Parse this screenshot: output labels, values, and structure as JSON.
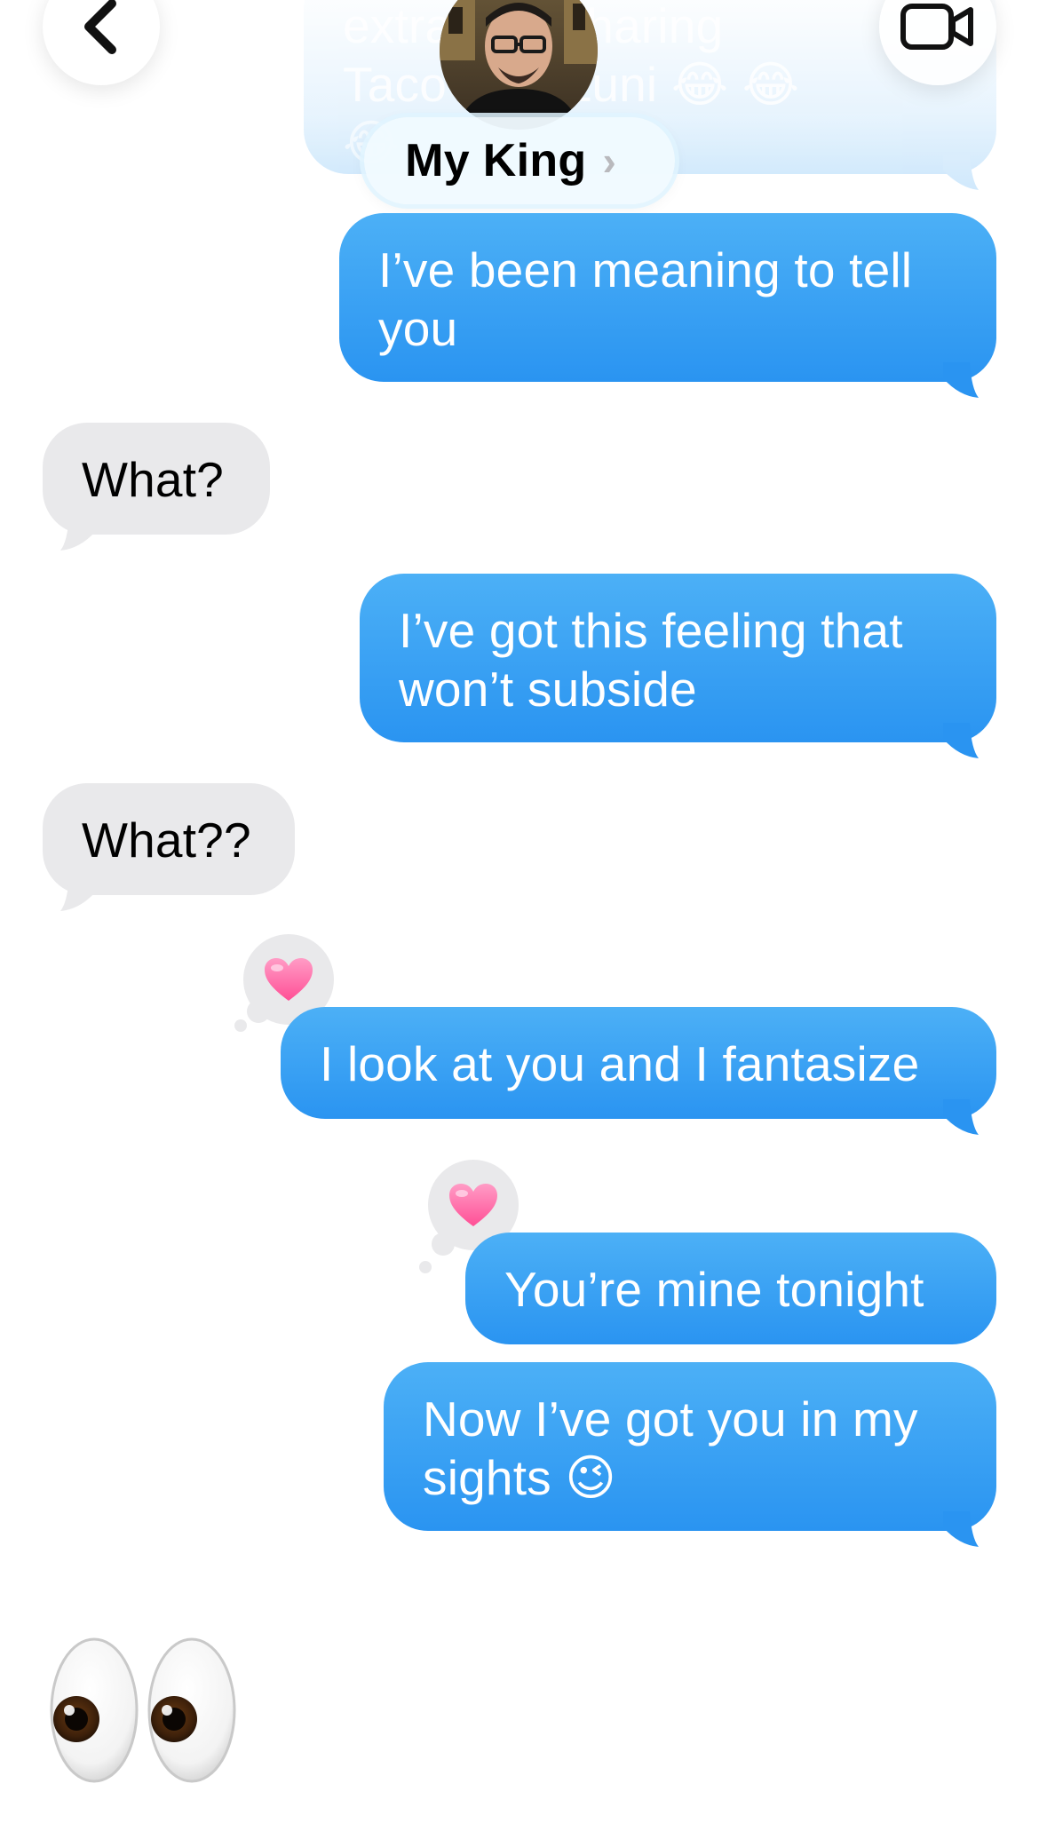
{
  "header": {
    "contact_name": "My King",
    "chevron": "chevron-right-icon",
    "back_icon": "chevron-left-icon",
    "video_icon": "video-camera-icon",
    "avatar": "contact-avatar-photo"
  },
  "colors": {
    "outgoing_bubble": "#2a94f1",
    "incoming_bubble": "#e9e9eb",
    "reaction_heart": "#ff6fa8"
  },
  "messages": [
    {
      "id": "m0",
      "direction": "outgoing",
      "text": "extra … and sharing … Taco … with Zuni 😂 😂 😂",
      "partially_hidden": true
    },
    {
      "id": "m1",
      "direction": "outgoing",
      "text": "I’ve been meaning to tell you"
    },
    {
      "id": "m2",
      "direction": "incoming",
      "text": "What?"
    },
    {
      "id": "m3",
      "direction": "outgoing",
      "text": "I’ve got this feeling that won’t subside"
    },
    {
      "id": "m4",
      "direction": "incoming",
      "text": "What??"
    },
    {
      "id": "m5",
      "direction": "outgoing",
      "text": "I look at you and I fantasize",
      "reaction": "pink-heart"
    },
    {
      "id": "m6",
      "direction": "outgoing",
      "text": "You’re mine tonight",
      "reaction": "pink-heart"
    },
    {
      "id": "m7",
      "direction": "outgoing",
      "text": "Now I’ve got you in my sights 😉"
    },
    {
      "id": "m8",
      "direction": "incoming",
      "text": "👀",
      "emoji_only": true
    }
  ],
  "faded_top": {
    "line1": "extra       and sharing",
    "line2": "Taco      with Zuni 😂 😂",
    "line3": "😂"
  }
}
